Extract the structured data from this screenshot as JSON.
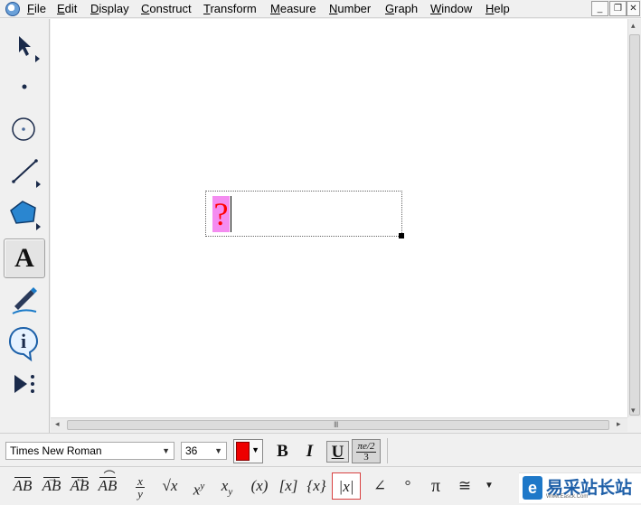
{
  "menubar": {
    "items": [
      "File",
      "Edit",
      "Display",
      "Construct",
      "Transform",
      "Measure",
      "Number",
      "Graph",
      "Window",
      "Help"
    ],
    "win_minimize": "_",
    "win_restore": "❐",
    "win_close": "✕"
  },
  "toolbox": {
    "tools": [
      "arrow-tool",
      "point-tool",
      "compass-tool",
      "straightedge-tool",
      "polygon-tool",
      "text-tool",
      "marker-tool",
      "information-tool",
      "custom-tool"
    ],
    "active": "text-tool",
    "text_tool_glyph": "A",
    "info_tool_glyph": "i"
  },
  "canvas": {
    "textbox": {
      "content": "?",
      "highlight_color": "#f48cf0",
      "text_color": "#ff0000"
    }
  },
  "scrollbars": {
    "grip": "III",
    "left_arrow": "◂",
    "right_arrow": "▸",
    "up_arrow": "▴",
    "down_arrow": "▾"
  },
  "textbar": {
    "font_family": "Times New Roman",
    "font_size": "36",
    "dropdown": "▼",
    "color": "#ee0000",
    "bold": "B",
    "italic": "I",
    "underline": "U",
    "underline_pressed": true,
    "fraction_label_num": "πe/2",
    "fraction_label_den": "3"
  },
  "mathbar": {
    "segment": "AB",
    "ray": "AB",
    "line": "AB",
    "arc": "AB",
    "fraction_num": "x",
    "fraction_den": "y",
    "sqrt": "√x",
    "power_base": "x",
    "power_exp": "y",
    "subscript_base": "x",
    "subscript_sub": "y",
    "parens": "(x)",
    "brackets": "[x]",
    "braces": "{x}",
    "abs": "|x|",
    "angle": "∠",
    "degree": "°",
    "pi": "π",
    "congruent": "≅",
    "more": "▼"
  },
  "watermark": {
    "logo": "e",
    "title": "易采站长站",
    "subtitle": "Www.Easck.Com"
  }
}
